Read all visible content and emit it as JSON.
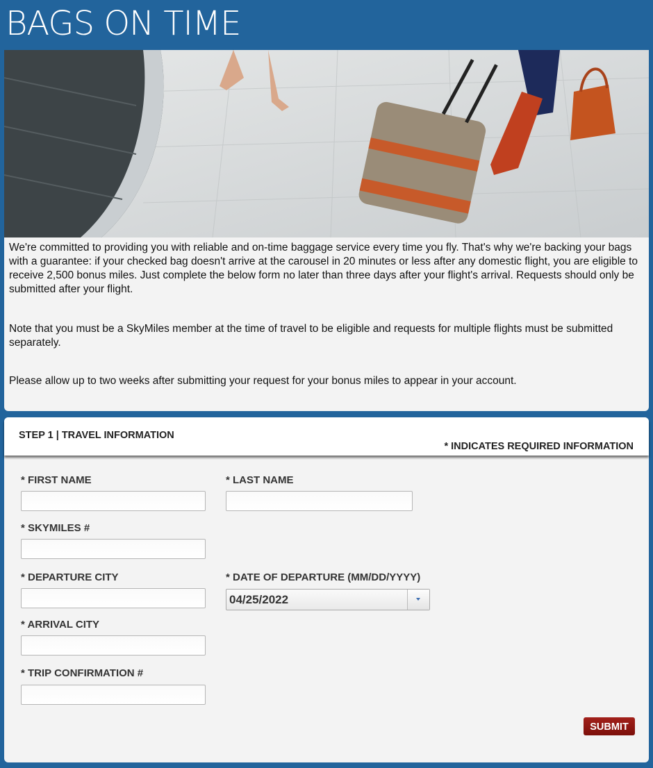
{
  "header": {
    "title": "BAGS ON TIME"
  },
  "hero": {
    "alt": "Travelers walking with luggage past a baggage carousel"
  },
  "intro": {
    "paragraphs": [
      "We're committed to providing you with reliable and on-time baggage service every time you fly. That's why we're backing your bags with a guarantee: if your checked bag doesn't arrive at the carousel in 20 minutes or less after any domestic flight, you are eligible to receive 2,500 bonus miles. Just complete the below form no later than three days after your flight's arrival. Requests should only be submitted after your flight.",
      "Note that you must be a SkyMiles member at the time of travel to be eligible and requests for multiple flights must be submitted separately.",
      "Please allow up to two weeks after submitting your request for your bonus miles to appear in your account."
    ]
  },
  "form": {
    "step_title": "STEP 1 | TRAVEL INFORMATION",
    "required_note": "* INDICATES REQUIRED INFORMATION",
    "fields": {
      "first_name": {
        "label": "* FIRST NAME",
        "value": ""
      },
      "last_name": {
        "label": "* LAST NAME",
        "value": ""
      },
      "skymiles": {
        "label": "* SKYMILES #",
        "value": ""
      },
      "departure_city": {
        "label": "* DEPARTURE CITY",
        "value": ""
      },
      "date_of_departure": {
        "label": "* DATE OF DEPARTURE (MM/DD/YYYY)",
        "value": "04/25/2022"
      },
      "arrival_city": {
        "label": "* ARRIVAL CITY",
        "value": ""
      },
      "trip_confirmation": {
        "label": "* TRIP CONFIRMATION #",
        "value": ""
      }
    },
    "submit_label": "SUBMIT"
  },
  "colors": {
    "brand_blue": "#22649c",
    "submit_red": "#8e1711"
  }
}
